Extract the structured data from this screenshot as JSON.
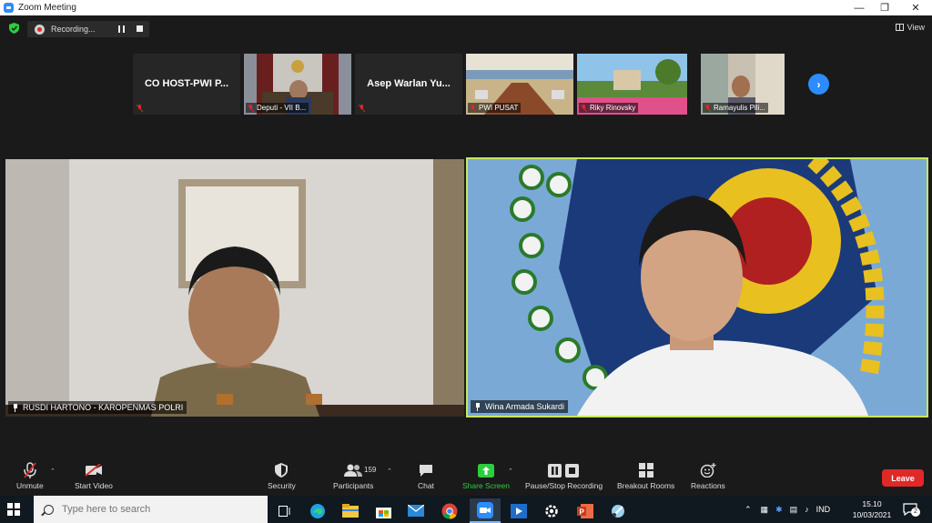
{
  "window": {
    "title": "Zoom Meeting",
    "controls": [
      "minimize",
      "maximize",
      "close"
    ]
  },
  "meeting_header": {
    "recording_label": "Recording...",
    "view_label": "View"
  },
  "filmstrip": [
    {
      "name": "CO HOST-PWI P...",
      "label": "",
      "type": "name-only"
    },
    {
      "name": "",
      "label": "Deputi - VII B...",
      "type": "video"
    },
    {
      "name": "Asep Warlan Yu...",
      "label": "",
      "type": "name-only"
    },
    {
      "name": "",
      "label": "PWI PUSAT",
      "type": "video"
    },
    {
      "name": "",
      "label": "Riky Rinovsky",
      "type": "video"
    },
    {
      "name": "",
      "label": "Ramayulis Pili...",
      "type": "video"
    }
  ],
  "videos": {
    "left_label": "RUSDI HARTONO - KAROPENMAS POLRI",
    "right_label": "Wina Armada Sukardi",
    "active_speaker_color": "#c8e65a"
  },
  "toolbar": {
    "unmute": "Unmute",
    "start_video": "Start Video",
    "security": "Security",
    "participants": "Participants",
    "participants_count": "159",
    "chat": "Chat",
    "share_screen": "Share Screen",
    "pause_stop_recording": "Pause/Stop Recording",
    "breakout_rooms": "Breakout Rooms",
    "reactions": "Reactions",
    "leave": "Leave"
  },
  "taskbar": {
    "search_placeholder": "Type here to search",
    "language": "IND",
    "time": "15.10",
    "date": "10/03/2021",
    "notifications": "2"
  },
  "colors": {
    "zoom_blue": "#2d8cff",
    "leave_red": "#e02828",
    "share_green": "#2ecc40"
  }
}
